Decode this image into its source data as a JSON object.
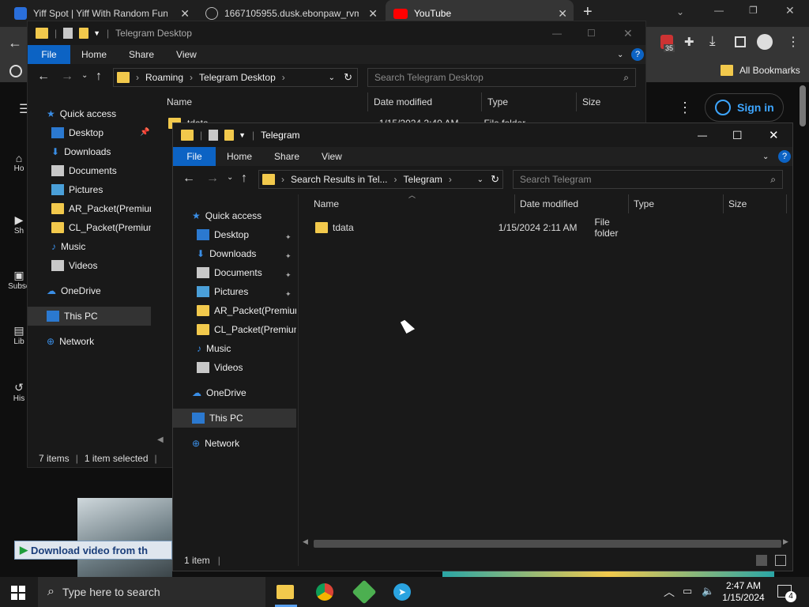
{
  "browser": {
    "tabs": [
      {
        "title": "Yiff Spot | Yiff With Random Fun",
        "active": false
      },
      {
        "title": "1667105955.dusk.ebonpaw_rvm",
        "active": false
      },
      {
        "title": "YouTube",
        "active": true
      }
    ],
    "new_tab": "+",
    "bookmarks_label": "All Bookmarks",
    "ext_badge": "35"
  },
  "youtube": {
    "sign_in": "Sign in",
    "sidebar": [
      "Ho",
      "Sh",
      "Subsc",
      "Lib",
      "His"
    ],
    "download_bar": "Download video from th"
  },
  "back_window": {
    "title": "Telegram Desktop",
    "ribbon": [
      "File",
      "Home",
      "Share",
      "View"
    ],
    "address": [
      "Roaming",
      "Telegram Desktop"
    ],
    "search_placeholder": "Search Telegram Desktop",
    "columns": [
      "Name",
      "Date modified",
      "Type",
      "Size"
    ],
    "first_row": {
      "name": "tdata",
      "date": "1/15/2024 2:40 AM",
      "type": "File folder"
    },
    "nav": [
      {
        "label": "Quick access",
        "icon": "star-icon",
        "pinned": false
      },
      {
        "label": "Desktop",
        "icon": "desktop-icon",
        "pinned": true
      },
      {
        "label": "Downloads",
        "icon": "download-icon",
        "pinned": true
      },
      {
        "label": "Documents",
        "icon": "document-icon",
        "pinned": true
      },
      {
        "label": "Pictures",
        "icon": "pictures-icon",
        "pinned": true
      },
      {
        "label": "AR_Packet(Premium",
        "icon": "folder-icon",
        "pinned": false
      },
      {
        "label": "CL_Packet(Premium",
        "icon": "folder-icon",
        "pinned": false
      },
      {
        "label": "Music",
        "icon": "music-icon",
        "pinned": false
      },
      {
        "label": "Videos",
        "icon": "videos-icon",
        "pinned": false
      },
      {
        "label": "OneDrive",
        "icon": "cloud-icon",
        "pinned": false
      },
      {
        "label": "This PC",
        "icon": "computer-icon",
        "pinned": false
      },
      {
        "label": "Network",
        "icon": "network-icon",
        "pinned": false
      }
    ],
    "status_items": "7 items",
    "status_selected": "1 item selected"
  },
  "front_window": {
    "title": "Telegram",
    "ribbon": [
      "File",
      "Home",
      "Share",
      "View"
    ],
    "address": [
      "Search Results in Tel...",
      "Telegram"
    ],
    "search_placeholder": "Search Telegram",
    "columns": [
      "Name",
      "Date modified",
      "Type",
      "Size"
    ],
    "rows": [
      {
        "name": "tdata",
        "date": "1/15/2024 2:11 AM",
        "type": "File folder",
        "size": ""
      }
    ],
    "nav": [
      {
        "label": "Quick access",
        "icon": "star-icon",
        "pinned": false
      },
      {
        "label": "Desktop",
        "icon": "desktop-icon",
        "pinned": true
      },
      {
        "label": "Downloads",
        "icon": "download-icon",
        "pinned": true
      },
      {
        "label": "Documents",
        "icon": "document-icon",
        "pinned": true
      },
      {
        "label": "Pictures",
        "icon": "pictures-icon",
        "pinned": true
      },
      {
        "label": "AR_Packet(Premium",
        "icon": "folder-icon",
        "pinned": false
      },
      {
        "label": "CL_Packet(Premium",
        "icon": "folder-icon",
        "pinned": false
      },
      {
        "label": "Music",
        "icon": "music-icon",
        "pinned": false
      },
      {
        "label": "Videos",
        "icon": "videos-icon",
        "pinned": false
      },
      {
        "label": "OneDrive",
        "icon": "cloud-icon",
        "pinned": false
      },
      {
        "label": "This PC",
        "icon": "computer-icon",
        "pinned": false
      },
      {
        "label": "Network",
        "icon": "network-icon",
        "pinned": false
      }
    ],
    "status_items": "1 item"
  },
  "taskbar": {
    "search_placeholder": "Type here to search",
    "time": "2:47 AM",
    "date": "1/15/2024",
    "notifications": "4"
  },
  "colors": {
    "accent": "#0c63c4",
    "folder": "#f2c94c",
    "youtube_red": "#ff0000",
    "link_blue": "#3ea6ff"
  }
}
